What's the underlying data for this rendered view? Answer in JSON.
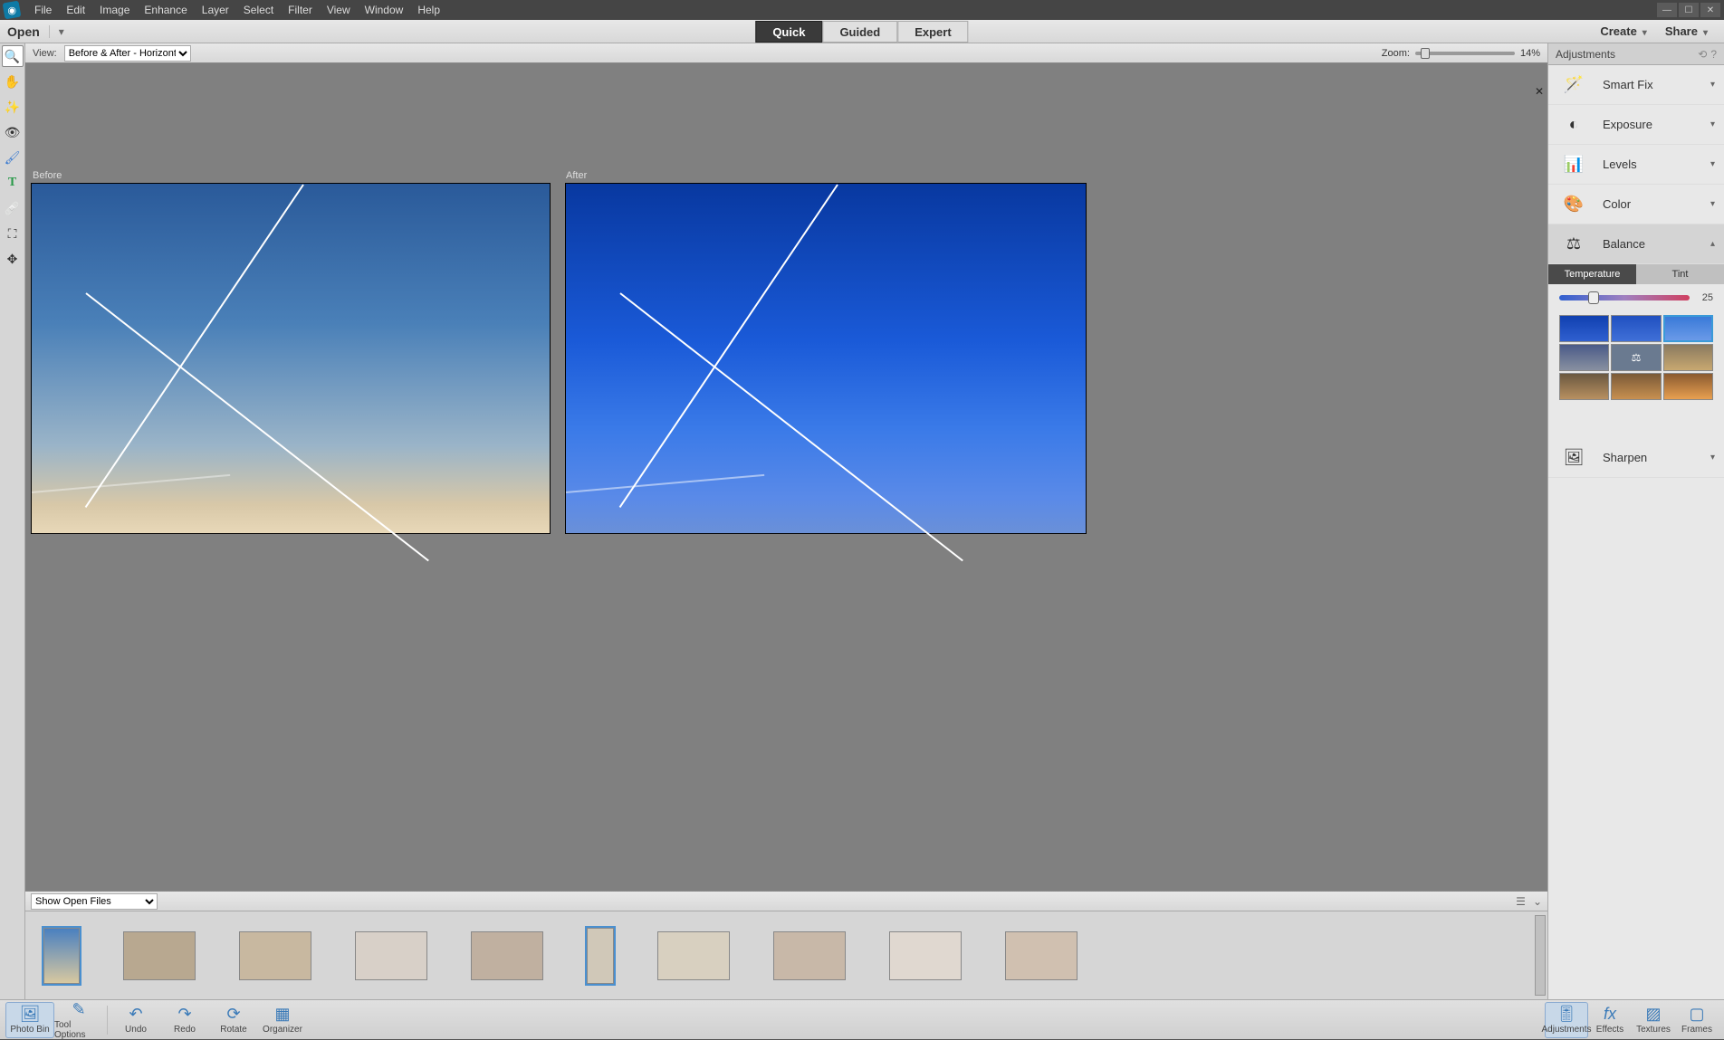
{
  "menubar": [
    "File",
    "Edit",
    "Image",
    "Enhance",
    "Layer",
    "Select",
    "Filter",
    "View",
    "Window",
    "Help"
  ],
  "toolbar": {
    "open": "Open"
  },
  "modes": {
    "quick": "Quick",
    "guided": "Guided",
    "expert": "Expert"
  },
  "actions": {
    "create": "Create",
    "share": "Share"
  },
  "viewbar": {
    "label": "View:",
    "selected": "Before & After - Horizontal",
    "zoom_label": "Zoom:",
    "zoom_value": "14%"
  },
  "canvas": {
    "before": "Before",
    "after": "After"
  },
  "filmstrip": {
    "select": "Show Open Files"
  },
  "adjustments": {
    "title": "Adjustments",
    "items": [
      "Smart Fix",
      "Exposure",
      "Levels",
      "Color",
      "Balance",
      "Sharpen"
    ],
    "balance": {
      "tabs": [
        "Temperature",
        "Tint"
      ],
      "value": "25"
    }
  },
  "bottombar": {
    "left": [
      "Photo Bin",
      "Tool Options",
      "Undo",
      "Redo",
      "Rotate",
      "Organizer"
    ],
    "right": [
      "Adjustments",
      "Effects",
      "Textures",
      "Frames"
    ]
  },
  "tools": [
    "zoom",
    "hand",
    "quick-select",
    "redeye",
    "whiten",
    "type",
    "spot-heal",
    "crop",
    "move"
  ]
}
